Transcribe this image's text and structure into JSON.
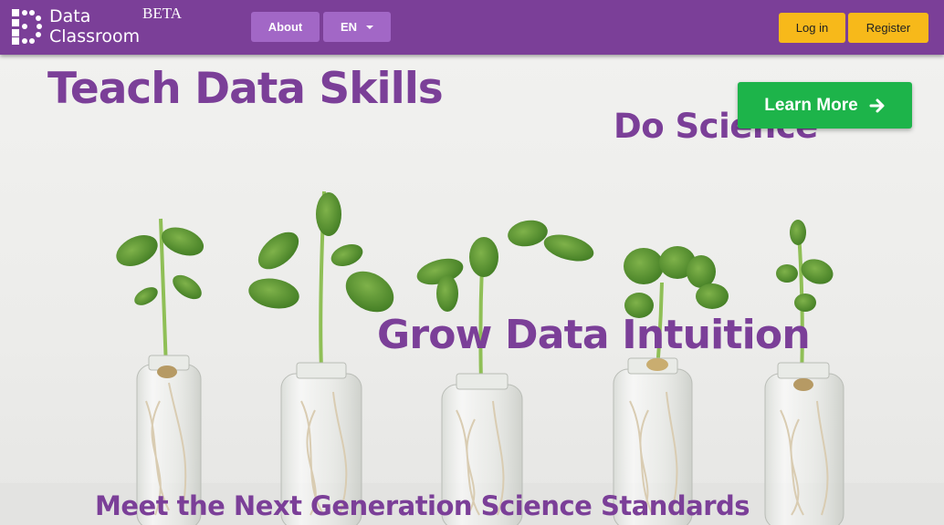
{
  "brand": {
    "logo_line1": "Data",
    "logo_line2": "Classroom",
    "beta_label": "BETA"
  },
  "nav": {
    "about_label": "About",
    "language_label": "EN",
    "login_label": "Log in",
    "register_label": "Register"
  },
  "hero": {
    "headline_1": "Teach Data Skills",
    "headline_2": "Do Science",
    "headline_3": "Grow Data Intuition",
    "headline_4": "Meet the Next Generation Science Standards",
    "cta_label": "Learn More"
  },
  "colors": {
    "brand_purple": "#7b3f98",
    "nav_button": "#a267c6",
    "auth_yellow": "#f7b91a",
    "cta_green": "#1db44a"
  },
  "icons": [
    "logo-dots-icon",
    "caret-down-icon",
    "arrow-right-icon"
  ]
}
